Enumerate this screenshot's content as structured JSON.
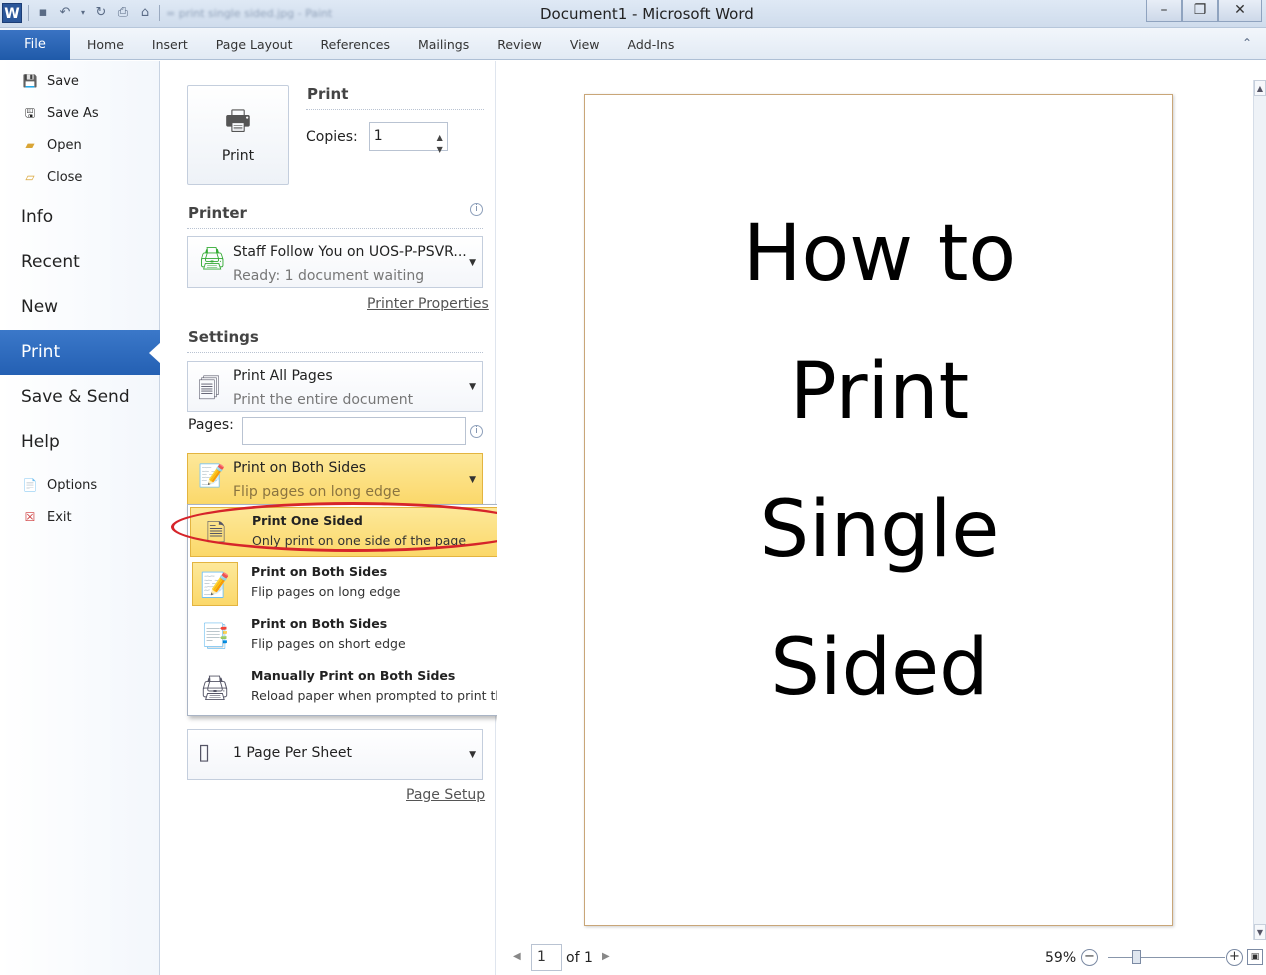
{
  "window": {
    "title": "Document1  -  Microsoft Word",
    "app_icon": "word-logo",
    "qat_blur_text": "= print single sided.jpg - Paint",
    "controls": [
      "minimize-icon",
      "restore-icon",
      "close-icon"
    ]
  },
  "ribbon": {
    "file_tab": "File",
    "tabs": [
      "Home",
      "Insert",
      "Page Layout",
      "References",
      "Mailings",
      "Review",
      "View",
      "Add-Ins"
    ]
  },
  "backstage_nav": {
    "small_items": [
      {
        "label": "Save",
        "icon": "save-icon"
      },
      {
        "label": "Save As",
        "icon": "save-as-icon"
      },
      {
        "label": "Open",
        "icon": "open-folder-icon"
      },
      {
        "label": "Close",
        "icon": "close-folder-icon"
      }
    ],
    "big_items": [
      "Info",
      "Recent",
      "New",
      "Print",
      "Save & Send",
      "Help"
    ],
    "active": "Print",
    "bottom_items": [
      {
        "label": "Options",
        "icon": "options-icon"
      },
      {
        "label": "Exit",
        "icon": "exit-icon"
      }
    ]
  },
  "print_panel": {
    "print_button_label": "Print",
    "print_heading": "Print",
    "copies_label": "Copies:",
    "copies_value": "1",
    "printer_heading": "Printer",
    "printer_name": "Staff Follow You on UOS-P-PSVR...",
    "printer_status": "Ready: 1 document waiting",
    "printer_properties_link": "Printer Properties",
    "settings_heading": "Settings",
    "pages_scope_title": "Print All Pages",
    "pages_scope_sub": "Print the entire document",
    "pages_label": "Pages:",
    "pages_value": "",
    "duplex_title": "Print on Both Sides",
    "duplex_sub": "Flip pages on long edge",
    "per_sheet": "1 Page Per Sheet",
    "page_setup_link": "Page Setup"
  },
  "duplex_menu": {
    "options": [
      {
        "title": "Print One Sided",
        "sub": "Only print on one side of the page",
        "icon": "one-sided-page-icon",
        "highlighted": true
      },
      {
        "title": "Print on Both Sides",
        "sub": "Flip pages on long edge",
        "icon": "long-edge-flip-icon",
        "current": true
      },
      {
        "title": "Print on Both Sides",
        "sub": "Flip pages on short edge",
        "icon": "short-edge-flip-icon"
      },
      {
        "title": "Manually Print on Both Sides",
        "sub": "Reload paper when prompted to print the second side",
        "icon": "manual-duplex-printer-icon"
      }
    ]
  },
  "preview": {
    "lines": [
      "How to",
      "Print",
      "Single",
      "Sided"
    ]
  },
  "status_bar": {
    "page_current": "1",
    "page_total": "of 1",
    "zoom": "59%"
  },
  "colors": {
    "file_tab": "#2b63b5",
    "active_nav": "#2d6cc0",
    "highlight": "#fbd86a",
    "annotation_ellipse": "#d6242a"
  }
}
